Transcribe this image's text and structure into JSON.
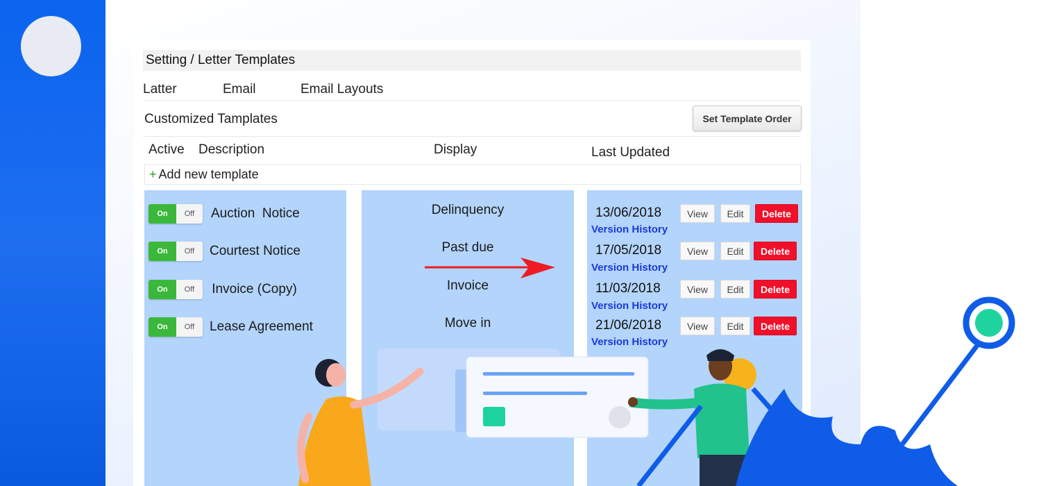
{
  "breadcrumb": "Setting / Letter Templates",
  "tabs": [
    {
      "label": "Latter"
    },
    {
      "label": "Email"
    },
    {
      "label": "Email Layouts"
    }
  ],
  "section_title": "Customized Tamplates",
  "set_order_button": "Set Template Order",
  "columns": {
    "active": "Active",
    "description": "Description",
    "display": "Display",
    "last_updated": "Last Updated"
  },
  "add_new": {
    "plus": "+",
    "label": "Add new template"
  },
  "toggle": {
    "on": "On",
    "off": "Off"
  },
  "templates": [
    {
      "name": "Auction  Notice",
      "display": "Delinquency",
      "date": "13/06/2018",
      "version_history": "Version History"
    },
    {
      "name": "Courtest Notice",
      "display": "Past due",
      "date": "17/05/2018",
      "version_history": "Version History"
    },
    {
      "name": " Invoice (Copy)",
      "display": "Invoice",
      "date": "11/03/2018",
      "version_history": "Version History"
    },
    {
      "name": "Lease Agreement",
      "display": "Move in",
      "date": "21/06/2018",
      "version_history": "Version History"
    }
  ],
  "row_actions": {
    "view": "View",
    "edit": "Edit",
    "delete": "Delete"
  },
  "colors": {
    "brand_blue": "#0a64ee",
    "toggle_on": "#3bb83b",
    "delete_red": "#f0102a",
    "link_blue": "#1a3ad8",
    "column_fill": "#b3d4fb",
    "arrow_red": "#ee1b24"
  }
}
